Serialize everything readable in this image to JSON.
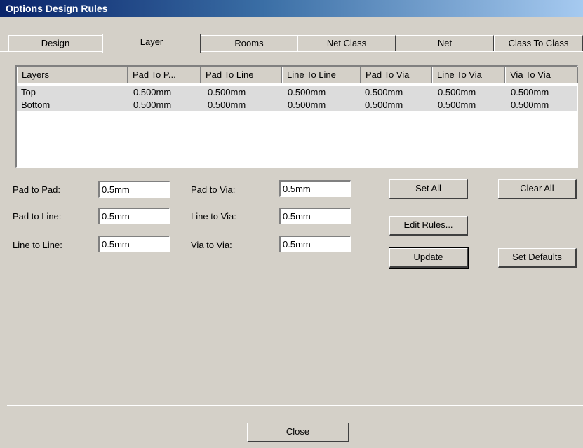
{
  "window": {
    "title": "Options Design Rules"
  },
  "tabs": [
    "Design",
    "Layer",
    "Rooms",
    "Net Class",
    "Net",
    "Class To Class"
  ],
  "active_tab": "Layer",
  "table": {
    "columns": [
      "Layers",
      "Pad To P...",
      "Pad To Line",
      "Line To Line",
      "Pad To Via",
      "Line To Via",
      "Via To Via"
    ],
    "rows": [
      [
        "Top",
        "0.500mm",
        "0.500mm",
        "0.500mm",
        "0.500mm",
        "0.500mm",
        "0.500mm"
      ],
      [
        "Bottom",
        "0.500mm",
        "0.500mm",
        "0.500mm",
        "0.500mm",
        "0.500mm",
        "0.500mm"
      ]
    ]
  },
  "fields": {
    "pad_to_pad": {
      "label": "Pad to Pad:",
      "value": "0.5mm"
    },
    "pad_to_line": {
      "label": "Pad to Line:",
      "value": "0.5mm"
    },
    "line_to_line": {
      "label": "Line to Line:",
      "value": "0.5mm"
    },
    "pad_to_via": {
      "label": "Pad to Via:",
      "value": "0.5mm"
    },
    "line_to_via": {
      "label": "Line to Via:",
      "value": "0.5mm"
    },
    "via_to_via": {
      "label": "Via to Via:",
      "value": "0.5mm"
    }
  },
  "buttons": {
    "set_all": "Set All",
    "clear_all": "Clear All",
    "edit_rules": "Edit Rules...",
    "update": "Update",
    "set_defaults": "Set Defaults",
    "close": "Close"
  }
}
